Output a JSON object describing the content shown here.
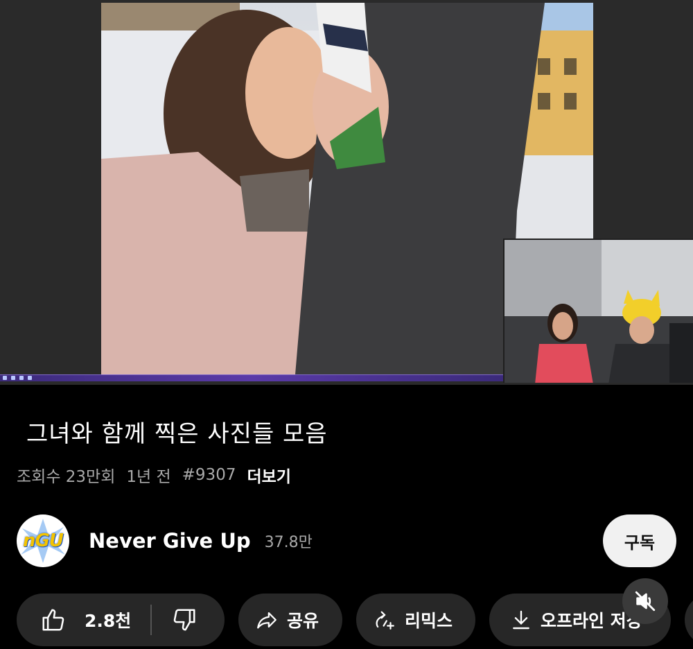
{
  "video": {
    "description_thumb": "video-frame"
  },
  "info": {
    "title": "그녀와 함께 찍은 사진들 모음",
    "views": "조회수 23만회",
    "uploaded": "1년 전",
    "hashtag": "#9307",
    "more": "더보기"
  },
  "channel": {
    "avatar_text": "nGU",
    "name": "Never Give Up",
    "subscribers": "37.8만",
    "subscribe_label": "구독"
  },
  "actions": {
    "like_count": "2.8천",
    "share_label": "공유",
    "remix_label": "리믹스",
    "offline_label": "오프라인 저장"
  },
  "colors": {
    "background": "#000000",
    "pill": "#272727",
    "subscribe_bg": "#f1f1f1",
    "secondary_text": "#aaaaaa"
  }
}
